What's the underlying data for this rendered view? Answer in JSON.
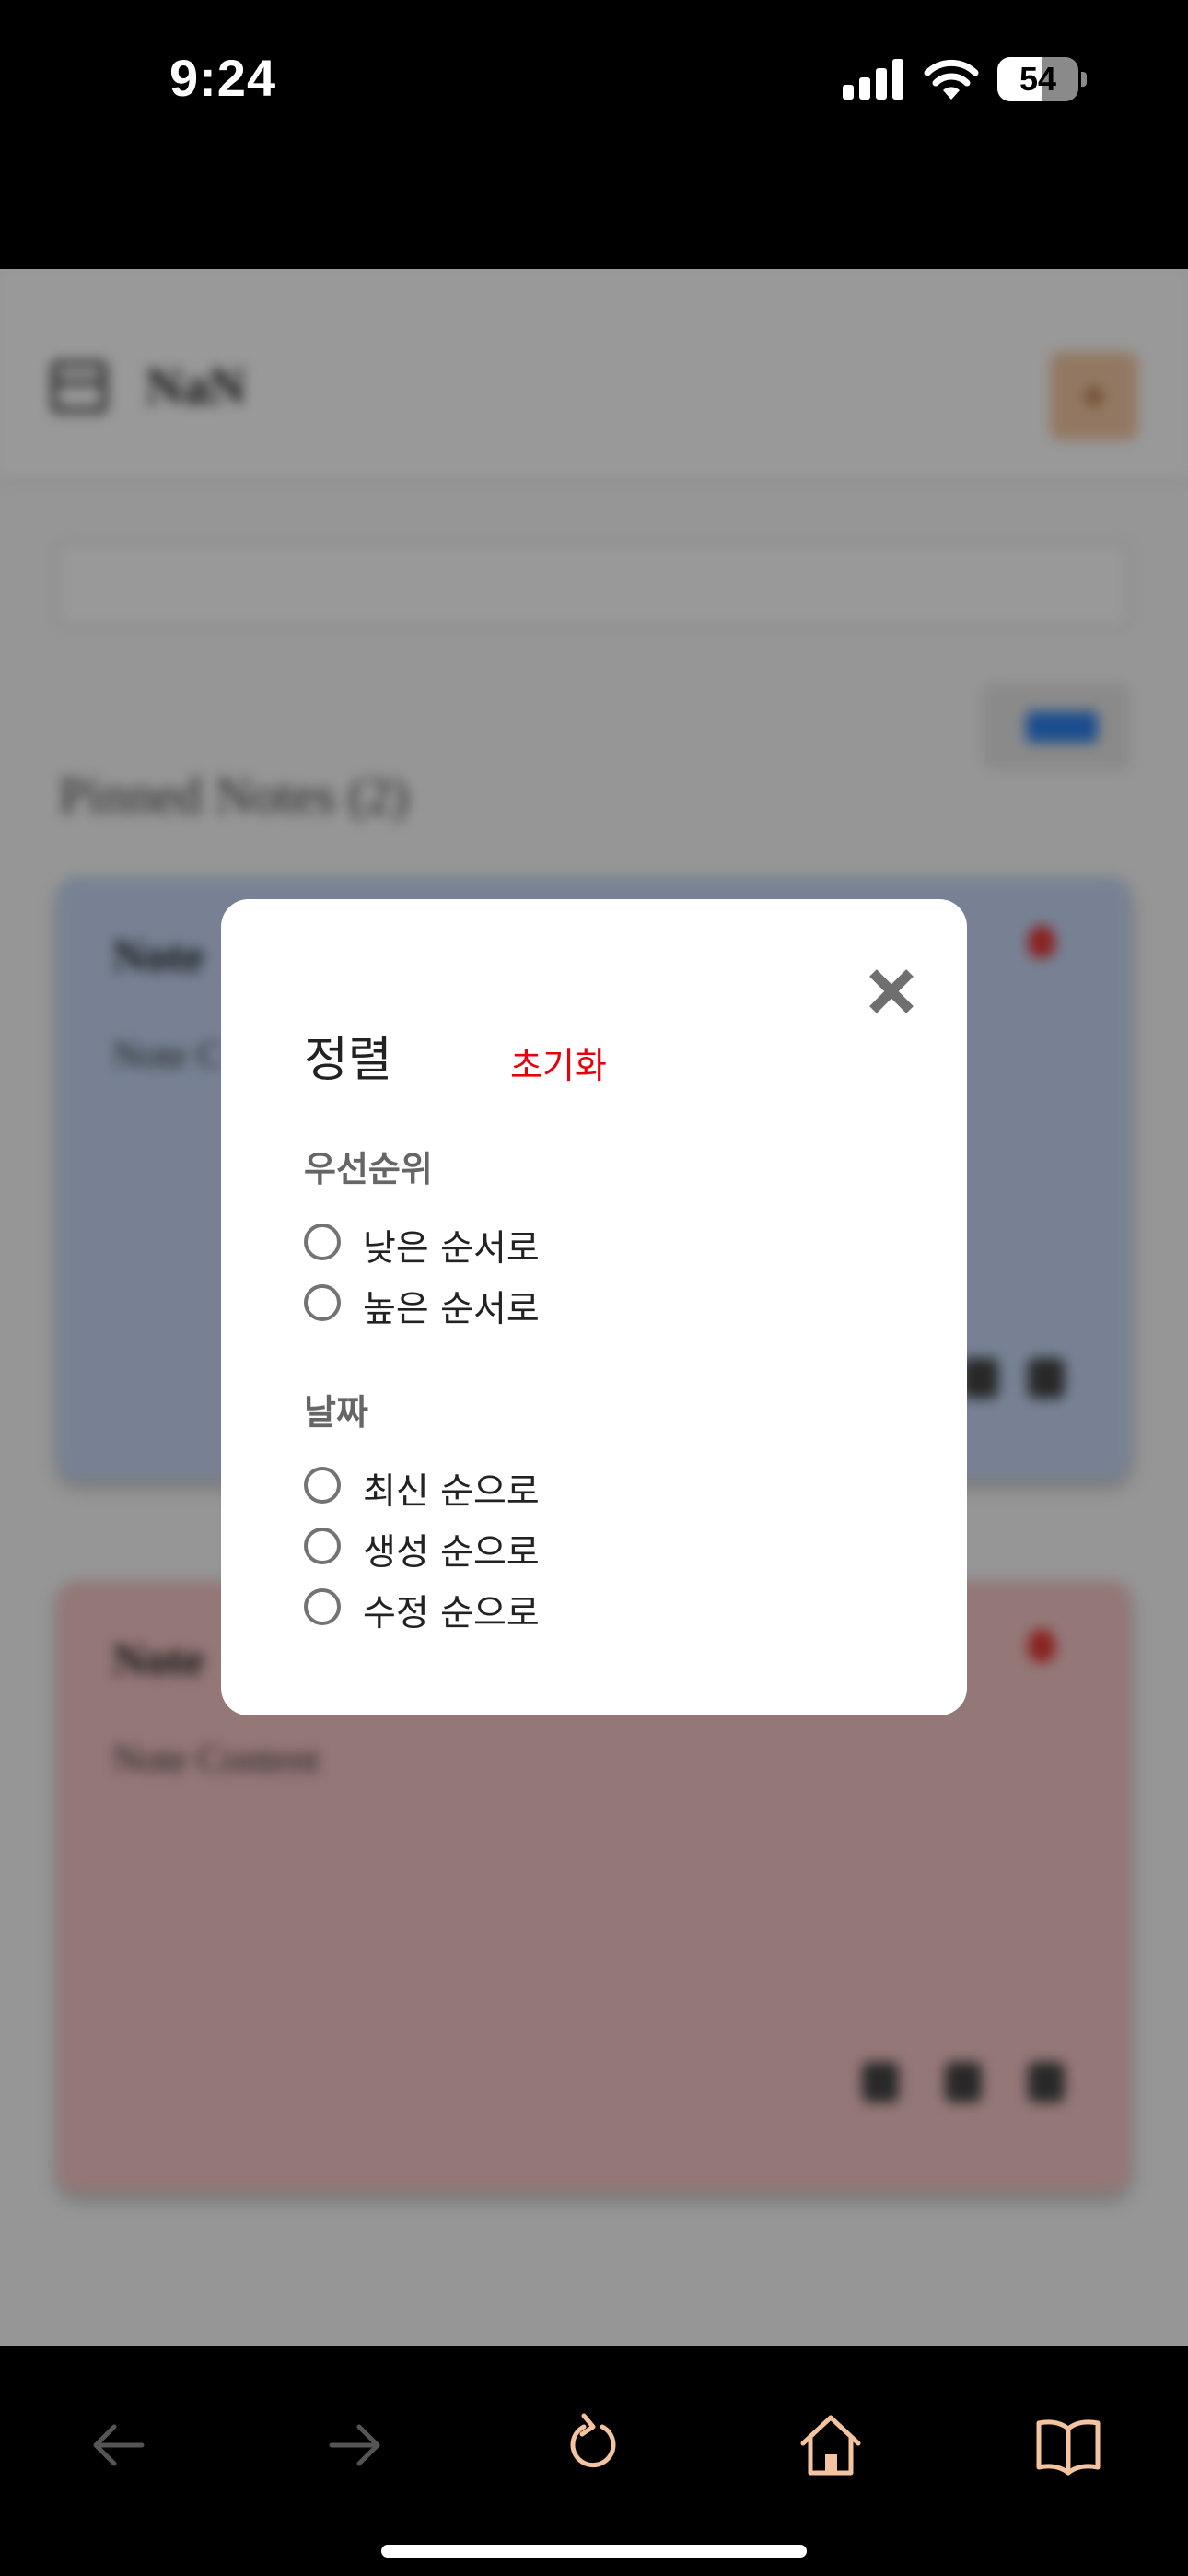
{
  "status_bar": {
    "time": "9:24",
    "battery_level": "54",
    "battery_fraction": 0.54
  },
  "app": {
    "title": "NaN",
    "add_button_label": "+",
    "search_placeholder": "",
    "sort_button_label": "",
    "section_title": "Pinned Notes (2)",
    "notes": [
      {
        "title": "Note",
        "content": "Note C",
        "tag": "",
        "date": "",
        "color": "#c6d8f6"
      },
      {
        "title": "Note",
        "content": "Note Content",
        "tag": "",
        "date": "",
        "color": "#f7c7c7"
      }
    ]
  },
  "modal": {
    "title": "정렬",
    "reset_label": "초기화",
    "close_icon": "close-icon",
    "groups": [
      {
        "label": "우선순위",
        "options": [
          "낮은 순서로",
          "높은 순서로"
        ]
      },
      {
        "label": "날짜",
        "options": [
          "최신 순으로",
          "생성 순으로",
          "수정 순으로"
        ]
      }
    ]
  },
  "toolbar": {
    "icons": [
      "back-arrow-icon",
      "forward-arrow-icon",
      "reload-icon",
      "home-icon",
      "bookmarks-icon"
    ]
  },
  "colors": {
    "accent_red": "#e8000b",
    "toolbar_active": "#f4c3a0",
    "toolbar_disabled": "#555555"
  }
}
